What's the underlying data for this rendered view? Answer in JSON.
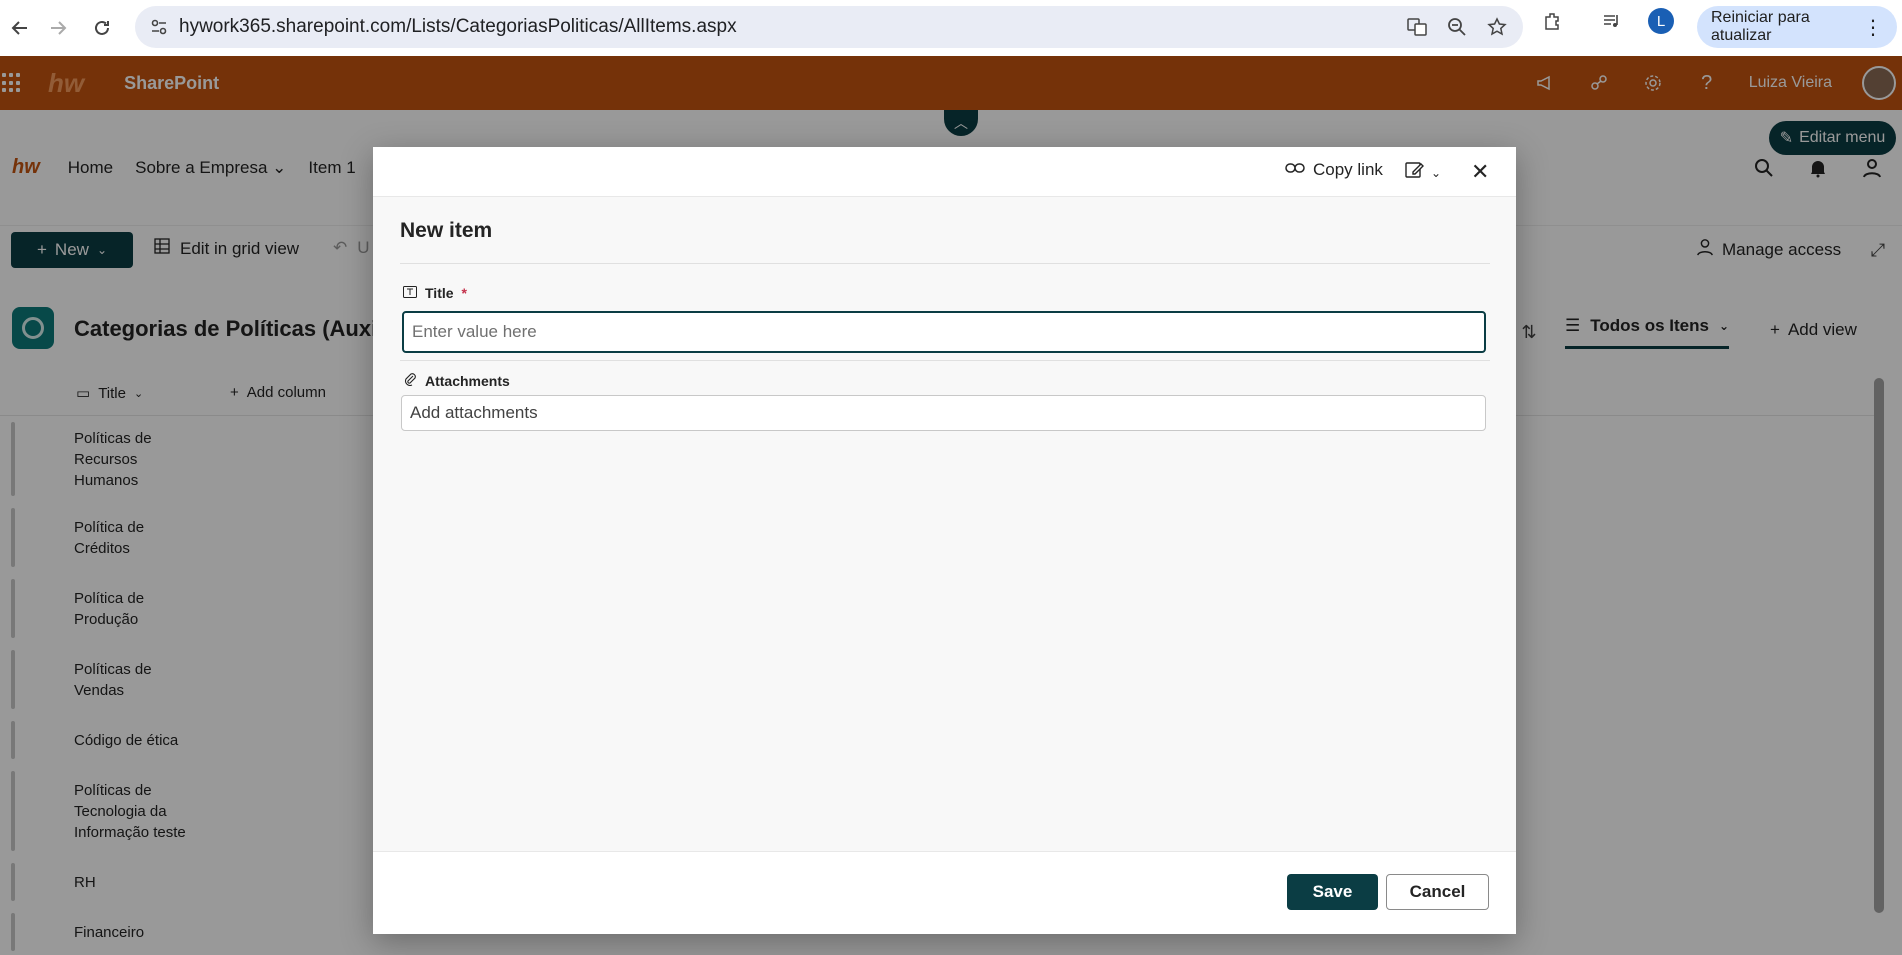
{
  "browser": {
    "url": "hywork365.sharepoint.com/Lists/CategoriasPoliticas/AllItems.aspx",
    "profile_initial": "L",
    "update_label": "Reiniciar para atualizar",
    "icons": [
      "back-icon",
      "forward-icon",
      "reload-icon",
      "site-info-icon",
      "translate-icon",
      "zoom-icon",
      "star-icon",
      "extensions-icon",
      "media-icon",
      "menu-icon"
    ]
  },
  "suitebar": {
    "app_name": "SharePoint",
    "logo_text": "hw",
    "user_name": "Luiza Vieira",
    "color": "#c4540f"
  },
  "site_header": {
    "logo_text": "hw",
    "nav": [
      "Home",
      "Sobre a Empresa",
      "Item 1"
    ],
    "edit_menu_label": "Editar menu"
  },
  "commandbar": {
    "new_label": "New",
    "edit_grid_label": "Edit in grid view",
    "undo_label": "U",
    "manage_access_label": "Manage access"
  },
  "list": {
    "title": "Categorias de Políticas (Auxi",
    "view_name": "Todos os Itens",
    "add_view_label": "Add view",
    "columns": {
      "title": "Title",
      "add_column": "Add column"
    },
    "rows": [
      "Políticas de Recursos Humanos",
      "Política de Créditos",
      "Política de Produção",
      "Políticas de Vendas",
      "Código de ética",
      "Políticas de Tecnologia da Informação teste",
      "RH",
      "Financeiro"
    ]
  },
  "dialog": {
    "copy_link_label": "Copy link",
    "heading": "New item",
    "title_field": {
      "label": "Title",
      "required_mark": "*",
      "placeholder": "Enter value here",
      "value": ""
    },
    "attachments_field": {
      "label": "Attachments",
      "placeholder": "Add attachments"
    },
    "save_label": "Save",
    "cancel_label": "Cancel",
    "accent_color": "#0b3d44"
  }
}
